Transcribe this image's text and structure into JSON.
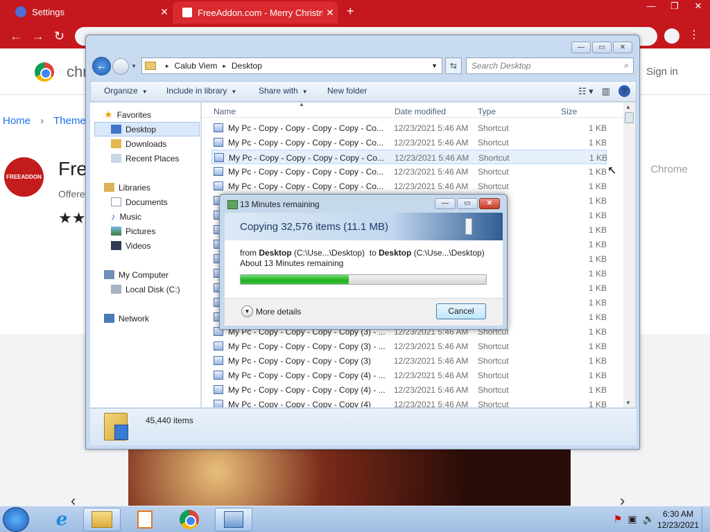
{
  "browser": {
    "tabs": [
      {
        "title": "Settings",
        "close": "✕"
      },
      {
        "title": "FreeAddon.com - Merry Christmas",
        "close": "✕"
      }
    ],
    "new_tab": "+",
    "win_controls": [
      "—",
      "❐",
      "✕"
    ],
    "nav": {
      "back": "←",
      "forward": "→",
      "reload": "↻"
    }
  },
  "webpage": {
    "brand": "chr",
    "sign_in": "Sign in",
    "breadcrumb": [
      "Home",
      "Themes"
    ],
    "breadcrumb_sep": "›",
    "logo_text": "FREEADDON",
    "title": "Fre",
    "offered": "Offere",
    "stars": "★★",
    "add_button": "Chrome",
    "arrow_left": "‹",
    "arrow_right": "›"
  },
  "explorer": {
    "controls": [
      "—",
      "▭",
      "✕"
    ],
    "path": [
      "Calub Viem",
      "Desktop"
    ],
    "path_sep": "▸",
    "search_placeholder": "Search Desktop",
    "toolbar": [
      "Organize",
      "Include in library",
      "Share with",
      "New folder"
    ],
    "nav": {
      "favorites": "Favorites",
      "desktop": "Desktop",
      "downloads": "Downloads",
      "recent": "Recent Places",
      "libraries": "Libraries",
      "documents": "Documents",
      "music": "Music",
      "pictures": "Pictures",
      "videos": "Videos",
      "computer": "My Computer",
      "localdisk": "Local Disk (C:)",
      "network": "Network"
    },
    "columns": {
      "name": "Name",
      "date": "Date modified",
      "type": "Type",
      "size": "Size"
    },
    "rows": [
      {
        "name": "My Pc - Copy - Copy - Copy - Copy - Co...",
        "date": "12/23/2021 5:46 AM",
        "type": "Shortcut",
        "size": "1 KB"
      },
      {
        "name": "My Pc - Copy - Copy - Copy - Copy - Co...",
        "date": "12/23/2021 5:46 AM",
        "type": "Shortcut",
        "size": "1 KB"
      },
      {
        "name": "My Pc - Copy - Copy - Copy - Copy - Co...",
        "date": "12/23/2021 5:46 AM",
        "type": "Shortcut",
        "size": "1 KB"
      },
      {
        "name": "My Pc - Copy - Copy - Copy - Copy - Co...",
        "date": "12/23/2021 5:46 AM",
        "type": "Shortcut",
        "size": "1 KB"
      },
      {
        "name": "My Pc - Copy - Copy - Copy - Copy - Co...",
        "date": "12/23/2021 5:46 AM",
        "type": "Shortcut",
        "size": "1 KB"
      },
      {
        "name": "",
        "date": "",
        "type": "",
        "size": "1 KB"
      },
      {
        "name": "",
        "date": "",
        "type": "",
        "size": "1 KB"
      },
      {
        "name": "",
        "date": "",
        "type": "",
        "size": "1 KB"
      },
      {
        "name": "",
        "date": "",
        "type": "",
        "size": "1 KB"
      },
      {
        "name": "",
        "date": "",
        "type": "",
        "size": "1 KB"
      },
      {
        "name": "",
        "date": "",
        "type": "",
        "size": "1 KB"
      },
      {
        "name": "",
        "date": "",
        "type": "",
        "size": "1 KB"
      },
      {
        "name": "",
        "date": "",
        "type": "",
        "size": "1 KB"
      },
      {
        "name": "",
        "date": "",
        "type": "",
        "size": "1 KB"
      },
      {
        "name": "My Pc - Copy - Copy - Copy - Copy (3) - ...",
        "date": "12/23/2021 5:46 AM",
        "type": "Shortcut",
        "size": "1 KB"
      },
      {
        "name": "My Pc - Copy - Copy - Copy - Copy (3) - ...",
        "date": "12/23/2021 5:46 AM",
        "type": "Shortcut",
        "size": "1 KB"
      },
      {
        "name": "My Pc - Copy - Copy - Copy - Copy (3)",
        "date": "12/23/2021 5:46 AM",
        "type": "Shortcut",
        "size": "1 KB"
      },
      {
        "name": "My Pc - Copy - Copy - Copy - Copy (4) - ...",
        "date": "12/23/2021 5:46 AM",
        "type": "Shortcut",
        "size": "1 KB"
      },
      {
        "name": "My Pc - Copy - Copy - Copy - Copy (4) - ...",
        "date": "12/23/2021 5:46 AM",
        "type": "Shortcut",
        "size": "1 KB"
      },
      {
        "name": "My Pc - Copy - Copy - Copy - Copy (4)",
        "date": "12/23/2021 5:46 AM",
        "type": "Shortcut",
        "size": "1 KB"
      }
    ],
    "item_count": "45,440 items"
  },
  "dialog": {
    "title": "13 Minutes remaining",
    "heading": "Copying 32,576 items (11.1 MB)",
    "from_label": "from",
    "from_name": "Desktop",
    "from_path": "(C:\\Use...\\Desktop)",
    "to_label": "to",
    "to_name": "Desktop",
    "to_path": "(C:\\Use...\\Desktop)",
    "remaining": "About 13 Minutes remaining",
    "progress": 0.44,
    "more_details": "More details",
    "cancel": "Cancel",
    "controls": [
      "—",
      "▭",
      "✕"
    ]
  },
  "taskbar": {
    "ie_glyph": "e",
    "clock_time": "6:30 AM",
    "clock_date": "12/23/2021"
  },
  "cursor": "↖"
}
